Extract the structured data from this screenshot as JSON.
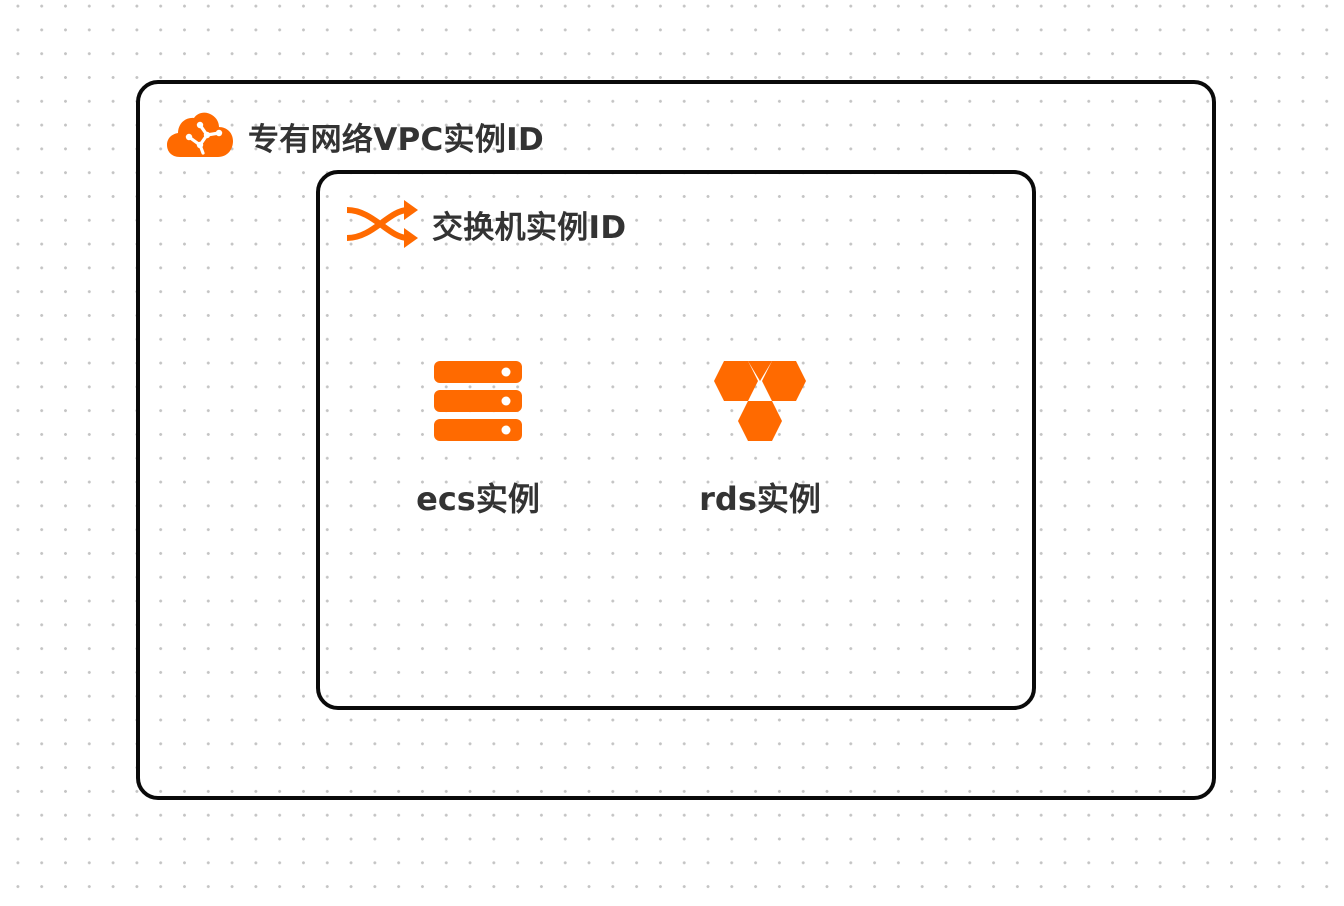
{
  "diagram": {
    "vpc": {
      "label": "专有网络VPC实例ID",
      "icon": "vpc-cloud-icon"
    },
    "vswitch": {
      "label": "交换机实例ID",
      "icon": "vswitch-shuffle-icon"
    },
    "nodes": [
      {
        "label": "ecs实例",
        "icon": "ecs-server-icon"
      },
      {
        "label": "rds实例",
        "icon": "rds-hexagon-icon"
      }
    ]
  },
  "colors": {
    "accent": "#FF6A00",
    "border": "#0A0A0A",
    "text": "#333333"
  }
}
